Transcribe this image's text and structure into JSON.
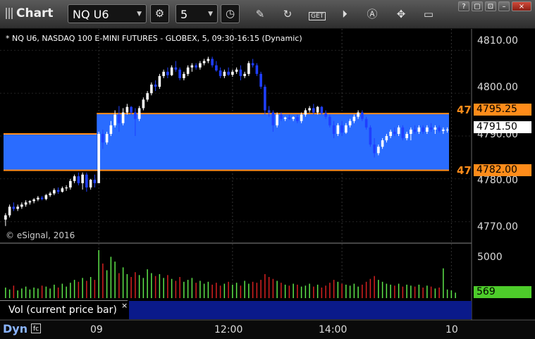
{
  "window": {
    "title": "Chart"
  },
  "toolbar": {
    "symbol": "NQ U6",
    "interval": "5",
    "icons": [
      "settings-gear-icon",
      "clock-icon",
      "pencil-icon",
      "refresh-icon",
      "get-icon",
      "play-icon",
      "alert-icon",
      "cursor-icon",
      "comment-icon"
    ]
  },
  "window_controls": {
    "help": "?",
    "restore": "▢",
    "close": "×"
  },
  "chart_header": "* NQ U6, NASDAQ 100 E-MINI FUTURES - GLOBEX, 5, 09:30-16:15 (Dynamic)",
  "copyright": "© eSignal, 2016",
  "price_axis": [
    "4810.00",
    "4800.00",
    "4790.00",
    "4780.00",
    "4770.00"
  ],
  "price_tags": {
    "upper": "4795.25",
    "current": "4791.50",
    "lower": "4782.00"
  },
  "level_prefix": "47",
  "volume_axis": {
    "top": "5000",
    "current": "569"
  },
  "volume_panel": {
    "label": "Vol (current price bar)",
    "close": "×"
  },
  "footer": {
    "dyn": "Dyn"
  },
  "time_axis": [
    "09",
    "12:00",
    "14:00",
    "10"
  ],
  "colors": {
    "bull": "#ffffff",
    "bear": "#1f3fff",
    "zone": "#2a6cff",
    "level": "#ff8c1a",
    "vol_up": "#5ee64a",
    "vol_down": "#d62020",
    "current_vol": "#4dcc2a"
  },
  "chart_data": {
    "type": "candlestick",
    "symbol": "NQ U6",
    "ylim": [
      4765,
      4815
    ],
    "zones": [
      {
        "bar_start": 0,
        "bar_end": 23,
        "low": 4782.0,
        "high": 4790.5
      },
      {
        "bar_start": 23,
        "bar_end": 110,
        "low": 4782.0,
        "high": 4795.25
      }
    ],
    "levels": [
      4795.25,
      4782.0
    ],
    "candles": [
      [
        4770.5,
        4772.0,
        4769.0,
        4771.5
      ],
      [
        4771.5,
        4774.0,
        4771.0,
        4773.5
      ],
      [
        4773.5,
        4774.5,
        4772.5,
        4773.0
      ],
      [
        4773.0,
        4774.0,
        4772.5,
        4773.5
      ],
      [
        4773.5,
        4774.5,
        4773.0,
        4774.0
      ],
      [
        4774.0,
        4775.0,
        4773.5,
        4774.5
      ],
      [
        4774.5,
        4775.0,
        4774.0,
        4774.8
      ],
      [
        4774.8,
        4775.5,
        4774.3,
        4775.2
      ],
      [
        4775.2,
        4776.0,
        4774.8,
        4775.6
      ],
      [
        4775.6,
        4776.0,
        4775.0,
        4775.3
      ],
      [
        4775.3,
        4776.5,
        4775.0,
        4776.2
      ],
      [
        4776.2,
        4777.0,
        4775.8,
        4776.6
      ],
      [
        4776.6,
        4777.8,
        4776.2,
        4777.4
      ],
      [
        4777.4,
        4778.0,
        4776.5,
        4777.0
      ],
      [
        4777.0,
        4778.2,
        4776.8,
        4777.8
      ],
      [
        4777.8,
        4778.5,
        4777.2,
        4778.0
      ],
      [
        4778.0,
        4780.0,
        4777.5,
        4779.5
      ],
      [
        4779.5,
        4781.0,
        4779.0,
        4780.6
      ],
      [
        4780.6,
        4781.5,
        4778.5,
        4779.0
      ],
      [
        4779.0,
        4781.5,
        4777.5,
        4781.0
      ],
      [
        4781.0,
        4781.5,
        4777.0,
        4778.0
      ],
      [
        4778.0,
        4780.0,
        4777.5,
        4779.8
      ],
      [
        4779.8,
        4781.0,
        4778.0,
        4779.0
      ],
      [
        4779.0,
        4791.0,
        4779.0,
        4790.5
      ],
      [
        4790.5,
        4791.5,
        4787.0,
        4788.5
      ],
      [
        4788.5,
        4791.0,
        4788.0,
        4790.5
      ],
      [
        4790.5,
        4793.5,
        4790.0,
        4792.5
      ],
      [
        4792.5,
        4796.0,
        4792.0,
        4795.0
      ],
      [
        4795.0,
        4797.0,
        4791.0,
        4793.0
      ],
      [
        4793.0,
        4796.5,
        4792.5,
        4795.5
      ],
      [
        4795.5,
        4797.5,
        4795.0,
        4796.8
      ],
      [
        4796.8,
        4797.0,
        4795.0,
        4795.5
      ],
      [
        4795.5,
        4796.5,
        4790.0,
        4794.0
      ],
      [
        4794.0,
        4797.0,
        4793.5,
        4796.5
      ],
      [
        4796.5,
        4799.0,
        4796.0,
        4798.5
      ],
      [
        4798.5,
        4800.5,
        4798.0,
        4800.0
      ],
      [
        4800.0,
        4802.5,
        4799.5,
        4802.0
      ],
      [
        4802.0,
        4803.0,
        4800.5,
        4801.5
      ],
      [
        4801.5,
        4804.5,
        4801.0,
        4804.0
      ],
      [
        4804.0,
        4805.5,
        4803.5,
        4805.0
      ],
      [
        4805.0,
        4806.0,
        4803.5,
        4804.2
      ],
      [
        4804.2,
        4806.5,
        4804.0,
        4806.0
      ],
      [
        4806.0,
        4807.5,
        4805.0,
        4805.5
      ],
      [
        4805.5,
        4806.0,
        4803.0,
        4803.5
      ],
      [
        4803.5,
        4805.0,
        4803.0,
        4804.5
      ],
      [
        4804.5,
        4806.5,
        4804.0,
        4806.0
      ],
      [
        4806.0,
        4807.0,
        4805.0,
        4806.5
      ],
      [
        4806.5,
        4807.0,
        4805.5,
        4806.0
      ],
      [
        4806.0,
        4807.5,
        4805.5,
        4807.0
      ],
      [
        4807.0,
        4808.0,
        4806.5,
        4807.5
      ],
      [
        4807.5,
        4808.5,
        4807.0,
        4808.0
      ],
      [
        4808.0,
        4808.5,
        4806.0,
        4806.5
      ],
      [
        4806.5,
        4807.5,
        4805.0,
        4805.3
      ],
      [
        4805.3,
        4806.0,
        4803.5,
        4804.0
      ],
      [
        4804.0,
        4805.5,
        4803.5,
        4805.0
      ],
      [
        4805.0,
        4806.0,
        4804.0,
        4804.3
      ],
      [
        4804.3,
        4805.5,
        4803.8,
        4805.0
      ],
      [
        4805.0,
        4806.0,
        4804.5,
        4805.5
      ],
      [
        4805.5,
        4806.5,
        4803.0,
        4804.0
      ],
      [
        4804.0,
        4805.0,
        4803.5,
        4804.5
      ],
      [
        4804.5,
        4807.5,
        4804.0,
        4807.0
      ],
      [
        4807.0,
        4808.0,
        4806.0,
        4806.5
      ],
      [
        4806.5,
        4807.0,
        4804.0,
        4804.5
      ],
      [
        4804.5,
        4805.0,
        4801.0,
        4801.5
      ],
      [
        4801.5,
        4802.0,
        4795.0,
        4796.0
      ],
      [
        4796.0,
        4797.0,
        4794.5,
        4795.5
      ],
      [
        4795.5,
        4796.0,
        4791.0,
        4792.5
      ],
      [
        4792.5,
        4795.5,
        4792.0,
        4795.0
      ],
      [
        4795.0,
        4795.5,
        4793.5,
        4794.0
      ],
      [
        4794.0,
        4794.5,
        4793.5,
        4794.3
      ],
      [
        4794.3,
        4795.0,
        4793.8,
        4794.0
      ],
      [
        4794.0,
        4794.6,
        4793.5,
        4794.4
      ],
      [
        4794.4,
        4795.0,
        4793.0,
        4793.5
      ],
      [
        4793.5,
        4795.5,
        4793.0,
        4795.0
      ],
      [
        4795.0,
        4796.5,
        4794.5,
        4796.0
      ],
      [
        4796.0,
        4797.0,
        4795.5,
        4796.5
      ],
      [
        4796.5,
        4797.5,
        4795.0,
        4795.5
      ],
      [
        4795.5,
        4797.0,
        4795.0,
        4796.8
      ],
      [
        4796.8,
        4797.0,
        4795.0,
        4795.3
      ],
      [
        4795.3,
        4796.0,
        4794.0,
        4794.5
      ],
      [
        4794.5,
        4795.0,
        4792.0,
        4792.5
      ],
      [
        4792.5,
        4793.5,
        4789.5,
        4790.5
      ],
      [
        4790.5,
        4793.0,
        4790.0,
        4792.5
      ],
      [
        4792.5,
        4793.5,
        4790.0,
        4790.8
      ],
      [
        4790.8,
        4793.0,
        4790.5,
        4792.5
      ],
      [
        4792.5,
        4794.0,
        4792.0,
        4793.5
      ],
      [
        4793.5,
        4795.0,
        4793.0,
        4794.5
      ],
      [
        4794.5,
        4796.0,
        4794.0,
        4795.5
      ],
      [
        4795.5,
        4796.0,
        4793.5,
        4794.0
      ],
      [
        4794.0,
        4794.5,
        4791.5,
        4792.0
      ],
      [
        4792.0,
        4792.5,
        4787.5,
        4788.0
      ],
      [
        4788.0,
        4789.5,
        4785.0,
        4786.0
      ],
      [
        4786.0,
        4788.0,
        4785.5,
        4787.5
      ],
      [
        4787.5,
        4789.5,
        4787.0,
        4789.0
      ],
      [
        4789.0,
        4790.5,
        4788.5,
        4790.0
      ],
      [
        4790.0,
        4791.5,
        4789.5,
        4791.0
      ],
      [
        4791.0,
        4792.0,
        4790.0,
        4790.5
      ],
      [
        4790.5,
        4792.5,
        4790.0,
        4792.0
      ],
      [
        4792.0,
        4792.5,
        4789.0,
        4789.5
      ],
      [
        4789.5,
        4791.0,
        4789.0,
        4790.5
      ],
      [
        4790.5,
        4792.0,
        4789.0,
        4791.5
      ],
      [
        4791.5,
        4792.5,
        4790.5,
        4791.0
      ],
      [
        4791.0,
        4792.5,
        4790.5,
        4792.0
      ],
      [
        4792.0,
        4792.5,
        4790.5,
        4791.0
      ],
      [
        4791.0,
        4792.5,
        4790.5,
        4792.0
      ],
      [
        4792.0,
        4793.0,
        4791.0,
        4791.5
      ],
      [
        4791.5,
        4792.5,
        4790.5,
        4792.0
      ],
      [
        4792.0,
        4792.5,
        4790.8,
        4791.2
      ],
      [
        4791.2,
        4792.0,
        4790.5,
        4791.5
      ],
      [
        4791.5,
        4792.0,
        4790.8,
        4791.5
      ]
    ],
    "volumes": [
      1100,
      900,
      1300,
      800,
      1000,
      1200,
      900,
      1100,
      1000,
      1300,
      1200,
      1000,
      1400,
      1100,
      1500,
      1200,
      1600,
      1900,
      1700,
      2100,
      1800,
      2200,
      1900,
      5000,
      3600,
      2900,
      4300,
      3800,
      2600,
      3200,
      2500,
      2200,
      2700,
      2400,
      2100,
      3000,
      2600,
      2300,
      2500,
      2100,
      2400,
      2000,
      1800,
      2200,
      1700,
      1900,
      2100,
      1600,
      1800,
      1500,
      1700,
      1400,
      1600,
      1300,
      1500,
      1700,
      1400,
      1600,
      1300,
      1800,
      1500,
      1700,
      1600,
      1900,
      2500,
      2200,
      2000,
      1800,
      1600,
      1400,
      1300,
      1500,
      1400,
      1200,
      1300,
      1500,
      1200,
      1400,
      1100,
      1300,
      1600,
      1900,
      1700,
      1500,
      1400,
      1300,
      1500,
      1200,
      1400,
      1700,
      2000,
      2300,
      1900,
      1700,
      1500,
      1400,
      1300,
      1500,
      1200,
      1400,
      1300,
      1200,
      1400,
      1100,
      1300,
      1200,
      1000,
      1100,
      3100,
      900,
      800,
      569
    ],
    "volume_ylim": [
      0,
      5500
    ]
  }
}
